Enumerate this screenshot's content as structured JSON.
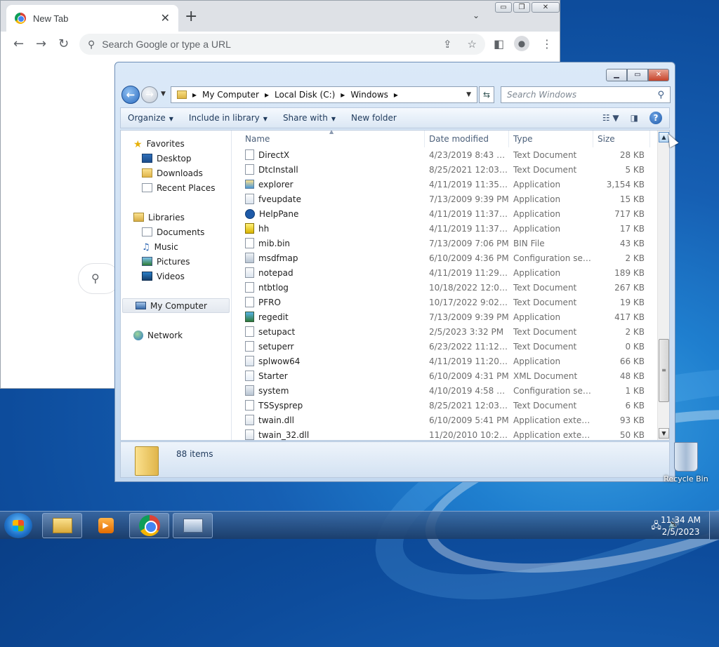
{
  "chrome": {
    "tab_title": "New Tab",
    "tab_close": "✕",
    "new_tab": "+",
    "omnibox_placeholder": "Search Google or type a URL",
    "window_controls": [
      "▭",
      "❐",
      "✕"
    ]
  },
  "explorer": {
    "address": {
      "crumbs": [
        "My Computer",
        "Local Disk (C:)",
        "Windows"
      ],
      "separator": "▸"
    },
    "search_placeholder": "Search Windows",
    "commands": [
      {
        "label": "Organize",
        "has_dropdown": true
      },
      {
        "label": "Include in library",
        "has_dropdown": true
      },
      {
        "label": "Share with",
        "has_dropdown": true
      },
      {
        "label": "New folder",
        "has_dropdown": false
      }
    ],
    "nav": {
      "favorites_label": "Favorites",
      "favorites": [
        "Desktop",
        "Downloads",
        "Recent Places"
      ],
      "libraries_label": "Libraries",
      "libraries": [
        "Documents",
        "Music",
        "Pictures",
        "Videos"
      ],
      "computer_label": "My Computer",
      "network_label": "Network"
    },
    "columns": {
      "name": "Name",
      "date": "Date modified",
      "type": "Type",
      "size": "Size"
    },
    "files": [
      {
        "name": "DirectX",
        "date": "4/23/2019 8:43 AM",
        "type": "Text Document",
        "size": "28 KB",
        "icon": "text"
      },
      {
        "name": "DtcInstall",
        "date": "8/25/2021 12:03 AM",
        "type": "Text Document",
        "size": "5 KB",
        "icon": "text"
      },
      {
        "name": "explorer",
        "date": "4/11/2019 11:35 PM",
        "type": "Application",
        "size": "3,154 KB",
        "icon": "explorer"
      },
      {
        "name": "fveupdate",
        "date": "7/13/2009 9:39 PM",
        "type": "Application",
        "size": "15 KB",
        "icon": "app"
      },
      {
        "name": "HelpPane",
        "date": "4/11/2019 11:37 PM",
        "type": "Application",
        "size": "717 KB",
        "icon": "help"
      },
      {
        "name": "hh",
        "date": "4/11/2019 11:37 PM",
        "type": "Application",
        "size": "17 KB",
        "icon": "hh"
      },
      {
        "name": "mib.bin",
        "date": "7/13/2009 7:06 PM",
        "type": "BIN File",
        "size": "43 KB",
        "icon": "text"
      },
      {
        "name": "msdfmap",
        "date": "6/10/2009 4:36 PM",
        "type": "Configuration sett...",
        "size": "2 KB",
        "icon": "config"
      },
      {
        "name": "notepad",
        "date": "4/11/2019 11:29 PM",
        "type": "Application",
        "size": "189 KB",
        "icon": "app"
      },
      {
        "name": "ntbtlog",
        "date": "10/18/2022 12:01 ...",
        "type": "Text Document",
        "size": "267 KB",
        "icon": "text"
      },
      {
        "name": "PFRO",
        "date": "10/17/2022 9:02 PM",
        "type": "Text Document",
        "size": "19 KB",
        "icon": "text"
      },
      {
        "name": "regedit",
        "date": "7/13/2009 9:39 PM",
        "type": "Application",
        "size": "417 KB",
        "icon": "regedit"
      },
      {
        "name": "setupact",
        "date": "2/5/2023 3:32 PM",
        "type": "Text Document",
        "size": "2 KB",
        "icon": "text"
      },
      {
        "name": "setuperr",
        "date": "6/23/2022 11:12 PM",
        "type": "Text Document",
        "size": "0 KB",
        "icon": "text"
      },
      {
        "name": "splwow64",
        "date": "4/11/2019 11:20 PM",
        "type": "Application",
        "size": "66 KB",
        "icon": "app"
      },
      {
        "name": "Starter",
        "date": "6/10/2009 4:31 PM",
        "type": "XML Document",
        "size": "48 KB",
        "icon": "xml"
      },
      {
        "name": "system",
        "date": "4/10/2019 4:58 AM",
        "type": "Configuration sett...",
        "size": "1 KB",
        "icon": "config"
      },
      {
        "name": "TSSysprep",
        "date": "8/25/2021 12:03 AM",
        "type": "Text Document",
        "size": "6 KB",
        "icon": "text"
      },
      {
        "name": "twain.dll",
        "date": "6/10/2009 5:41 PM",
        "type": "Application extens...",
        "size": "93 KB",
        "icon": "dll"
      },
      {
        "name": "twain_32.dll",
        "date": "11/20/2010 10:25 ...",
        "type": "Application extens...",
        "size": "50 KB",
        "icon": "dll"
      }
    ],
    "status_text": "88 items"
  },
  "desktop": {
    "recycle_bin_label": "Recycle Bin"
  },
  "taskbar": {
    "time": "11:34 AM",
    "date": "2/5/2023"
  }
}
